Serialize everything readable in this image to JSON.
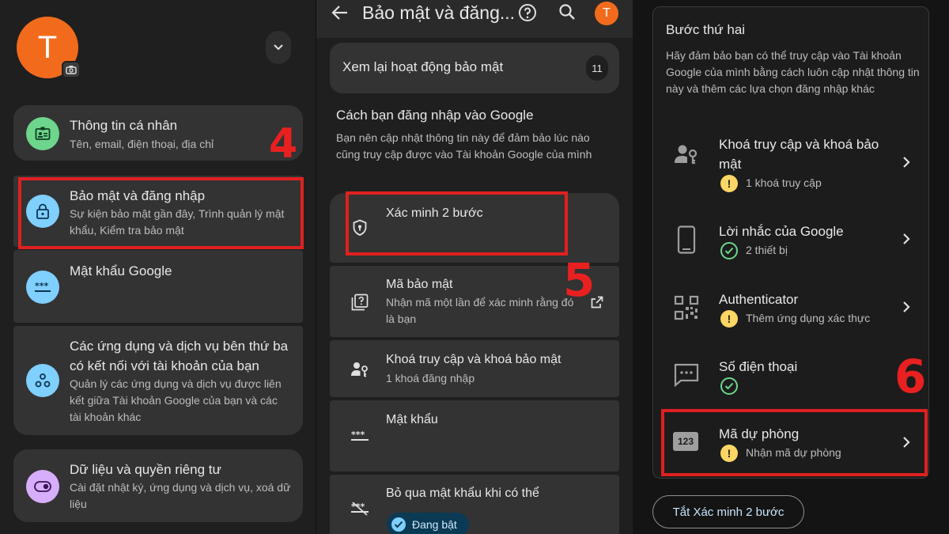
{
  "colors": {
    "accent_red": "#e02020",
    "avatar": "#f26b1d",
    "warn": "#fdd663",
    "ok": "#6dd58c"
  },
  "panel1": {
    "avatar_letter": "T",
    "step_number": "4",
    "items": [
      {
        "title": "Thông tin cá nhân",
        "subtitle": "Tên, email, điện thoại, địa chỉ",
        "icon": "id-card-icon"
      },
      {
        "title": "Bảo mật và đăng nhập",
        "subtitle": "Sự kiện bảo mật gần đây, Trình quản lý mật khẩu, Kiểm tra bảo mật",
        "icon": "lock-icon"
      },
      {
        "title": "Mật khẩu Google",
        "subtitle": "",
        "icon": "password-icon"
      },
      {
        "title": "Các ứng dụng và dịch vụ bên thứ ba có kết nối với tài khoản của bạn",
        "subtitle": "Quản lý các ứng dụng và dịch vụ được liên kết giữa Tài khoản Google của bạn và các tài khoản khác",
        "icon": "apps-icon"
      },
      {
        "title": "Dữ liệu và quyền riêng tư",
        "subtitle": "Cài đặt nhật ký, ứng dụng và dịch vụ, xoá dữ liệu",
        "icon": "toggle-icon"
      }
    ]
  },
  "panel2": {
    "title": "Bảo mật và đăng...",
    "avatar_letter": "T",
    "step_number": "5",
    "review": {
      "label": "Xem lại hoạt động bảo mật",
      "count": "11"
    },
    "section": {
      "heading": "Cách bạn đăng nhập vào Google",
      "description": "Bạn nên cập nhật thông tin này để đảm bảo lúc nào cũng truy cập được vào Tài khoản Google của mình"
    },
    "items": [
      {
        "title": "Xác minh 2 bước",
        "subtitle": "",
        "icon": "shield-icon"
      },
      {
        "title": "Mã bảo mật",
        "subtitle": "Nhận mã một lần để xác minh rằng đó là bạn",
        "icon": "help-box-icon"
      },
      {
        "title": "Khoá truy cập và khoá bảo mật",
        "subtitle": "1 khoá đăng nhập",
        "icon": "person-key-icon"
      },
      {
        "title": "Mật khẩu",
        "subtitle": "",
        "icon": "password-icon"
      },
      {
        "title": "Bỏ qua mật khẩu khi có thể",
        "subtitle": "",
        "icon": "password-off-icon"
      }
    ],
    "chip": "Đang bật"
  },
  "panel3": {
    "heading": "Bước thứ hai",
    "description": "Hãy đảm bảo bạn có thể truy cập vào Tài khoản Google của mình bằng cách luôn cập nhật thông tin này và thêm các lựa chọn đăng nhập khác",
    "step_number": "6",
    "items": [
      {
        "title": "Khoá truy cập và khoá bảo mật",
        "status": "1 khoá truy cập",
        "status_type": "warning",
        "icon": "person-key-icon"
      },
      {
        "title": "Lời nhắc của Google",
        "status": "2 thiết bị",
        "status_type": "ok",
        "icon": "phone-icon"
      },
      {
        "title": "Authenticator",
        "status": "Thêm ứng dụng xác thực",
        "status_type": "warning",
        "icon": "qr-code-icon"
      },
      {
        "title": "Số điện thoại",
        "status": "",
        "status_type": "ok",
        "icon": "sms-icon"
      },
      {
        "title": "Mã dự phòng",
        "status": "Nhận mã dự phòng",
        "status_type": "warning",
        "icon": "backup-codes-icon",
        "icon_text": "123"
      }
    ],
    "turn_off_button": "Tắt Xác minh 2 bước"
  }
}
